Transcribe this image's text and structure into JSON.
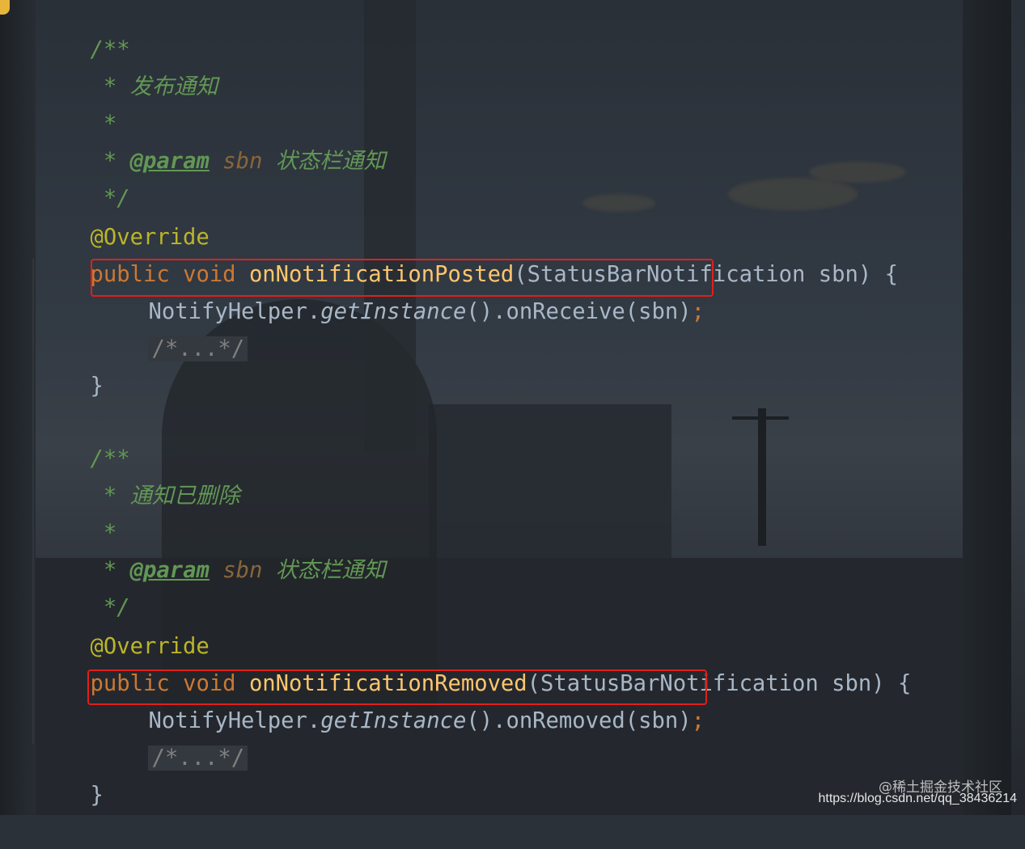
{
  "editor": {
    "block1": {
      "doc_open": "/**",
      "doc_star": "*",
      "doc_desc": "发布通知",
      "param_tag": "@param",
      "param_name": "sbn",
      "param_desc": "状态栏通知",
      "doc_close": "*/",
      "annotation": "@Override",
      "kw_public": "public",
      "kw_void": "void",
      "method": "onNotificationPosted",
      "signature_rest": "(StatusBarNotification sbn) {",
      "call_class": "NotifyHelper.",
      "call_static": "getInstance",
      "call_rest": "().onReceive(sbn)",
      "semicolon": ";",
      "folded": "/*...*/",
      "close_brace": "}"
    },
    "block2": {
      "doc_open": "/**",
      "doc_star": "*",
      "doc_desc": "通知已删除",
      "param_tag": "@param",
      "param_name": "sbn",
      "param_desc": "状态栏通知",
      "doc_close": "*/",
      "annotation": "@Override",
      "kw_public": "public",
      "kw_void": "void",
      "method": "onNotificationRemoved",
      "signature_rest": "(StatusBarNotification sbn) {",
      "call_class": "NotifyHelper.",
      "call_static": "getInstance",
      "call_rest": "().onRemoved(sbn)",
      "semicolon": ";",
      "folded": "/*...*/",
      "close_brace": "}"
    }
  },
  "colors": {
    "doc_comment": "#629755",
    "keyword": "#cc7832",
    "annotation": "#bbb529",
    "method_decl": "#ffc66d",
    "plain": "#a9b7c6",
    "highlight_box": "#e0201b"
  },
  "watermark": {
    "line1": "@稀土掘金技术社区",
    "line2": "https://blog.csdn.net/qq_38436214"
  }
}
